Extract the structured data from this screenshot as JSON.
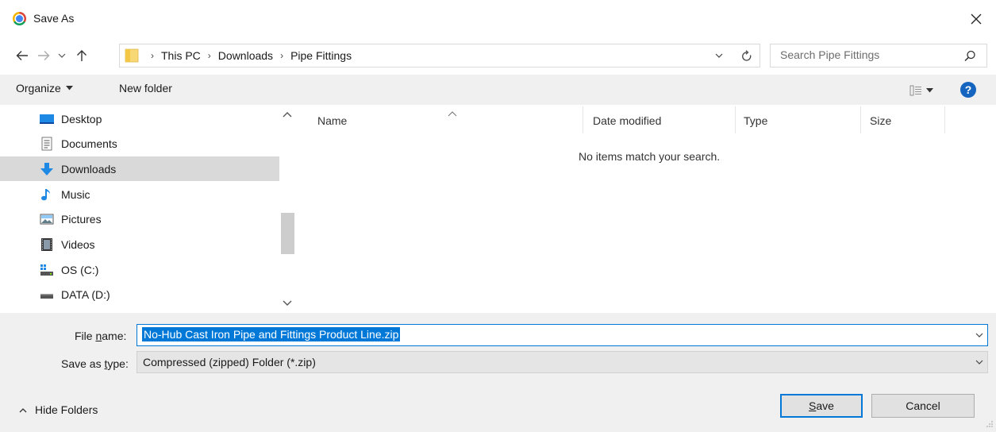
{
  "window": {
    "title": "Save As",
    "close_glyph": "✕",
    "app_icon": "chrome-icon"
  },
  "address": {
    "crumbs": [
      "This PC",
      "Downloads",
      "Pipe Fittings"
    ],
    "separator": "›"
  },
  "search": {
    "placeholder": "Search Pipe Fittings",
    "value": ""
  },
  "toolbar": {
    "organize_label": "Organize",
    "new_folder_label": "New folder",
    "help_glyph": "?"
  },
  "nav": {
    "items": [
      {
        "label": "Desktop",
        "icon": "desktop-icon"
      },
      {
        "label": "Documents",
        "icon": "documents-icon"
      },
      {
        "label": "Downloads",
        "icon": "downloads-icon",
        "selected": true
      },
      {
        "label": "Music",
        "icon": "music-icon"
      },
      {
        "label": "Pictures",
        "icon": "pictures-icon"
      },
      {
        "label": "Videos",
        "icon": "videos-icon"
      },
      {
        "label": "OS (C:)",
        "icon": "os-drive-icon"
      },
      {
        "label": "DATA (D:)",
        "icon": "drive-icon"
      }
    ]
  },
  "file_list": {
    "columns": [
      "Name",
      "Date modified",
      "Type",
      "Size"
    ],
    "empty_message": "No items match your search."
  },
  "form": {
    "filename_label_pre": "File ",
    "filename_label_u": "n",
    "filename_label_post": "ame:",
    "filename_value": "No-Hub Cast Iron Pipe and Fittings Product Line.zip",
    "type_label_pre": "Save as ",
    "type_label_u": "t",
    "type_label_post": "ype:",
    "type_value": "Compressed (zipped) Folder (*.zip)"
  },
  "footer": {
    "hide_folders_label": "Hide Folders",
    "save_label_u": "S",
    "save_label_rest": "ave",
    "cancel_label": "Cancel"
  },
  "colors": {
    "accent": "#0078d7",
    "toolbar_bg": "#f0f0f0",
    "selected_bg": "#d9d9d9"
  }
}
